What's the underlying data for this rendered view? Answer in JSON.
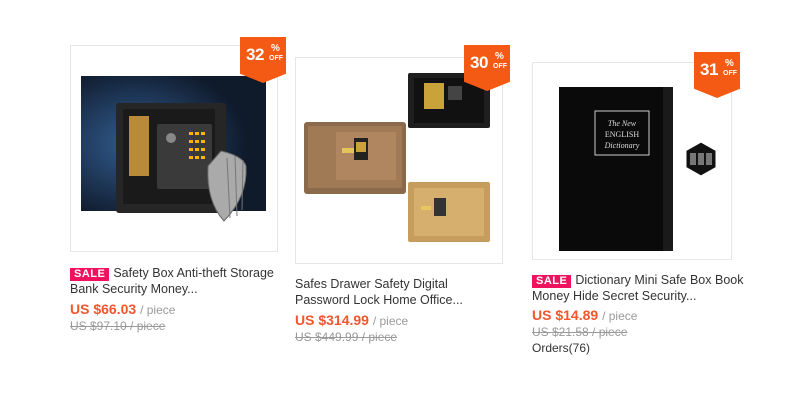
{
  "products": [
    {
      "discount": "32",
      "pct": "%",
      "off": "OFF",
      "sale": "SALE",
      "title": "Safety Box Anti-theft Storage Bank Security Money...",
      "price": "US $66.03",
      "unit": "/ piece",
      "old_price": "US $97.10 / piece"
    },
    {
      "discount": "30",
      "pct": "%",
      "off": "OFF",
      "title": "Safes Drawer Safety Digital Password Lock Home Office...",
      "price": "US $314.99",
      "unit": "/ piece",
      "old_price": "US $449.99 / piece"
    },
    {
      "discount": "31",
      "pct": "%",
      "off": "OFF",
      "sale": "SALE",
      "title": "Dictionary Mini Safe Box Book Money Hide Secret Security...",
      "price": "US $14.89",
      "unit": "/ piece",
      "old_price": "US $21.58 / piece",
      "orders": "Orders(76)"
    }
  ],
  "book_cover_text": "The New ENGLISH Dictionary",
  "colors": {
    "badge": "#f45a14",
    "sale": "#f0125d",
    "price": "#f2562e"
  }
}
